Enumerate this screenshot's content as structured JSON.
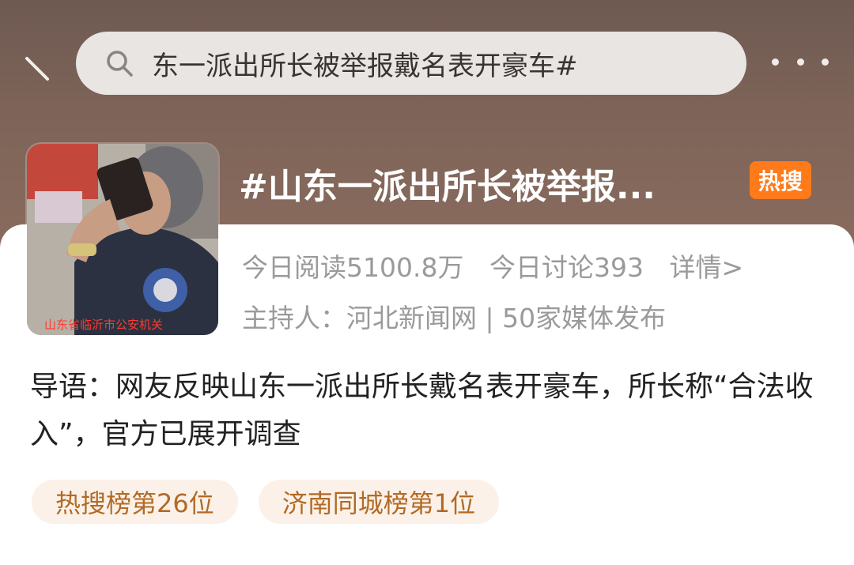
{
  "search": {
    "query": "东一派出所长被举报戴名表开豪车#"
  },
  "topic": {
    "title": "#山东一派出所长被举报...",
    "badge": "热搜",
    "image_caption": "山东省临沂市公安机关",
    "stats": {
      "reads": "今日阅读5100.8万",
      "discussions": "今日讨论393",
      "details_link": "详情>"
    },
    "host": "主持人：河北新闻网 | 50家媒体发布",
    "lead": "导语：网友反映山东一派出所长戴名表开豪车，所长称“合法收入”，官方已展开调查"
  },
  "tags": [
    "热搜榜第26位",
    "济南同城榜第1位"
  ],
  "colors": {
    "badge": "#ff7a1a",
    "tag_bg": "#fbf1e8",
    "tag_text": "#b26a25",
    "header_bg": "#7d6358"
  },
  "icons": [
    "back-icon",
    "search-icon",
    "more-icon"
  ]
}
